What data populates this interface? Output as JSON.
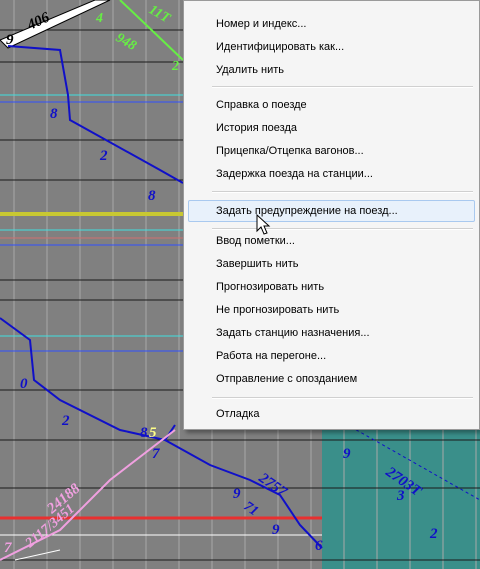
{
  "colors": {
    "background": "#808080",
    "teal_zone": "#3a8f8a",
    "train_blue": "#1010c8",
    "train_pink": "#f0a0e0",
    "train_green": "#66ee44",
    "stripe_yellow": "#c8c832",
    "stripe_red": "#e83030",
    "stripe_cyan": "#40e0e0"
  },
  "graph": {
    "top_left": {
      "route": "9",
      "train_numbers": [
        "406",
        "4",
        "948",
        "11T",
        "2"
      ]
    },
    "blue_labels": [
      "8",
      "2",
      "8",
      "0",
      "2",
      "8",
      "5",
      "7",
      "9",
      "2757",
      "71",
      "9",
      "6"
    ],
    "pink_labels": [
      "24188",
      "2117/3451",
      "7"
    ],
    "teal_labels": [
      "9",
      "2703T",
      "3",
      "2"
    ]
  },
  "menu": {
    "groups": [
      [
        "Номер и индекс...",
        "Идентифицировать как...",
        "Удалить нить"
      ],
      [
        "Справка о поезде",
        "История поезда",
        "Прицепка/Отцепка вагонов...",
        "Задержка поезда на станции..."
      ],
      [
        "Задать предупреждение на поезд..."
      ],
      [
        "Ввод пометки...",
        "Завершить нить",
        "Прогнозировать нить",
        "Не прогнозировать нить",
        "Задать станцию назначения...",
        "Работа на перегоне...",
        "Отправление с опозданием"
      ],
      [
        "Отладка"
      ]
    ],
    "highlighted": "Задать предупреждение на поезд..."
  }
}
